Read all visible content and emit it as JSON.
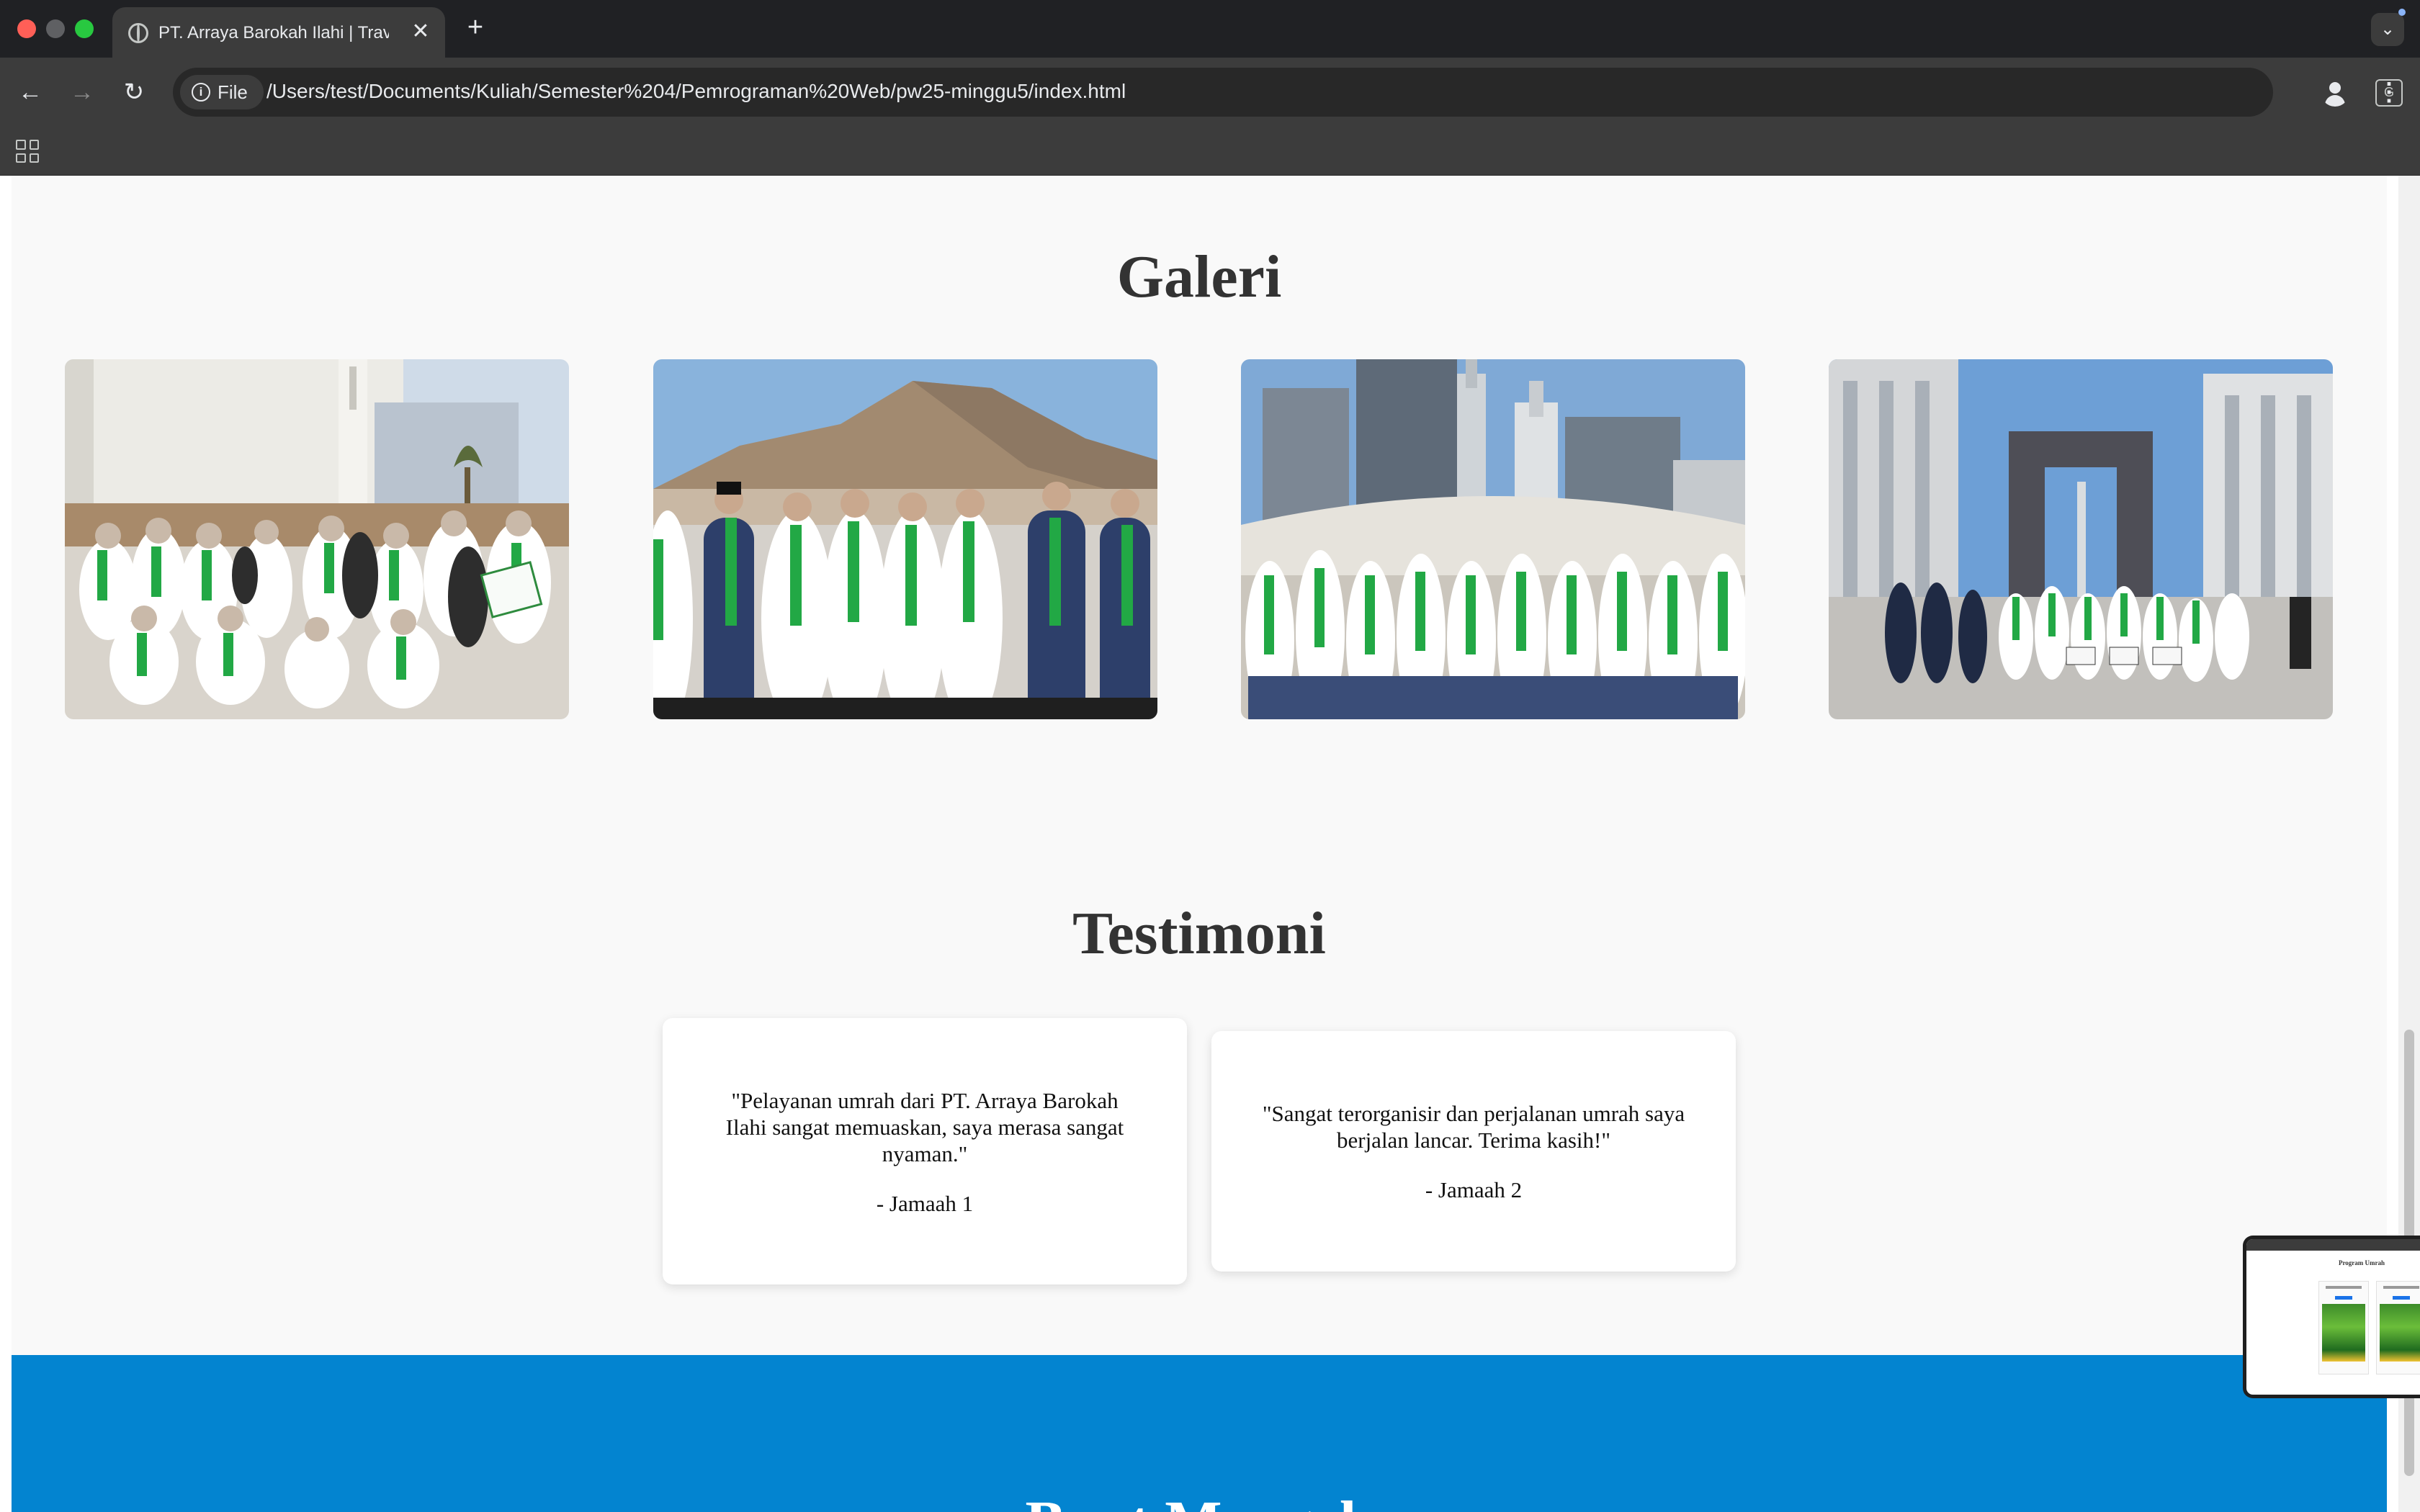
{
  "browser": {
    "tab": {
      "title": "PT. Arraya Barokah Ilahi | Travel",
      "close_glyph": "✕"
    },
    "new_tab_glyph": "+",
    "tab_search_glyph": "⌄",
    "nav": {
      "back_glyph": "←",
      "forward_glyph": "→",
      "reload_glyph": "↻"
    },
    "site_chip_label": "File",
    "url": "/Users/test/Documents/Kuliah/Semester%204/Pemrograman%20Web/pw25-minggu5/index.html",
    "translate_glyph": "G",
    "star_glyph": "☆",
    "menu_glyph": "⋮"
  },
  "page": {
    "gallery": {
      "title": "Galeri",
      "photos": [
        {
          "icon": "pilgrims-group-photo",
          "scene": "Group of pilgrims in white and green in front of a white mosque"
        },
        {
          "icon": "pilgrims-group-photo",
          "scene": "Pilgrims in batik uniforms in front of a rocky mountain"
        },
        {
          "icon": "pilgrims-group-photo",
          "scene": "Pilgrims in front of the clock tower and mosque towers"
        },
        {
          "icon": "pilgrims-group-photo",
          "scene": "Large group of pilgrims in a plaza with a gate monument"
        }
      ]
    },
    "testimonials": {
      "title": "Testimoni",
      "items": [
        {
          "quote": "\"Pelayanan umrah dari PT. Arraya Barokah Ilahi sangat memuaskan, saya merasa sangat nyaman.\"",
          "author": "- Jamaah 1"
        },
        {
          "quote": "\"Sangat terorganisir dan perjalanan umrah saya berjalan lancar. Terima kasih!\"",
          "author": "- Jamaah 2"
        }
      ]
    },
    "contact": {
      "title": "Buat Mengek"
    }
  },
  "pip_preview": {
    "title": "Program Umrah"
  },
  "colors": {
    "accent_blue": "#0384d0",
    "page_bg": "#f9f9f9",
    "chrome_dark": "#202124"
  }
}
